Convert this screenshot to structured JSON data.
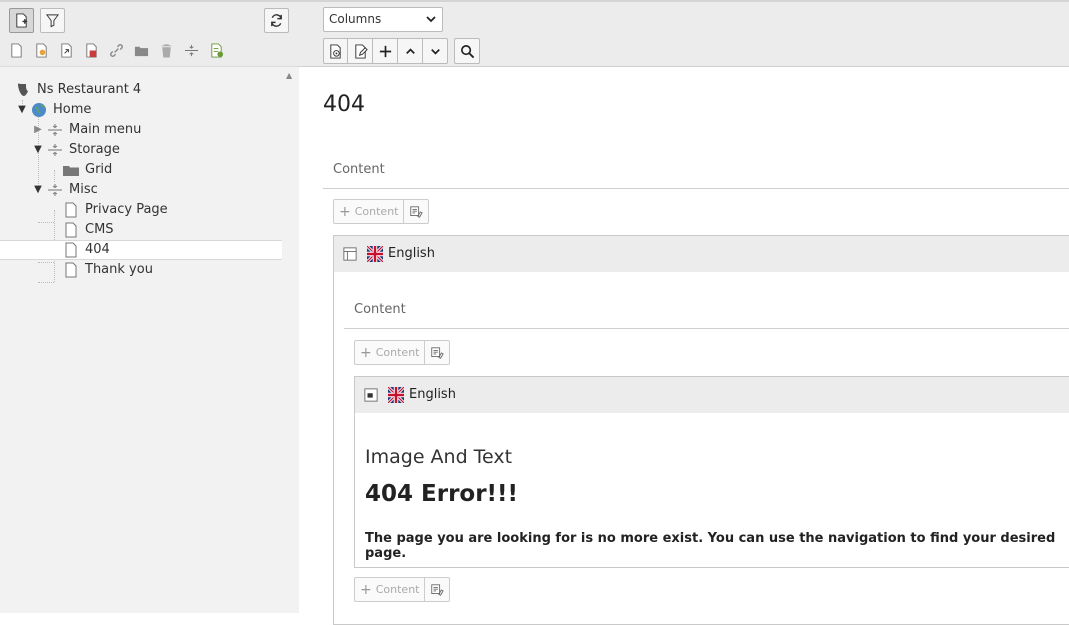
{
  "tree": {
    "root": "Ns Restaurant 4",
    "home": "Home",
    "main_menu": "Main menu",
    "storage": "Storage",
    "grid": "Grid",
    "misc": "Misc",
    "privacy": "Privacy Page",
    "cms": "CMS",
    "page404": "404",
    "thank_you": "Thank you"
  },
  "toolbar": {
    "view_select": "Columns",
    "view_select_options": [
      "Columns"
    ]
  },
  "main": {
    "page_title": "404",
    "outer_column": "Content",
    "new_content_label": "Content",
    "outer_ce_language": "English",
    "inner_column": "Content",
    "inner_ce_language": "English",
    "inner_ce_type": "Image And Text",
    "inner_ce_heading": "404 Error!!!",
    "inner_ce_body": "The page you are looking for is no more exist. You can use the navigation to find your desired page."
  },
  "icons": {
    "new_page": "new-page-icon",
    "filter": "filter-icon",
    "refresh": "refresh-icon",
    "preview": "preview-icon",
    "edit": "edit-icon",
    "add": "plus-icon",
    "up": "chevron-up-icon",
    "down": "chevron-down-icon",
    "search": "search-icon"
  },
  "colors": {
    "toolbar_bg": "#ececec",
    "tree_bg": "#f2f2f2",
    "home_globe": "#6aa84f"
  }
}
